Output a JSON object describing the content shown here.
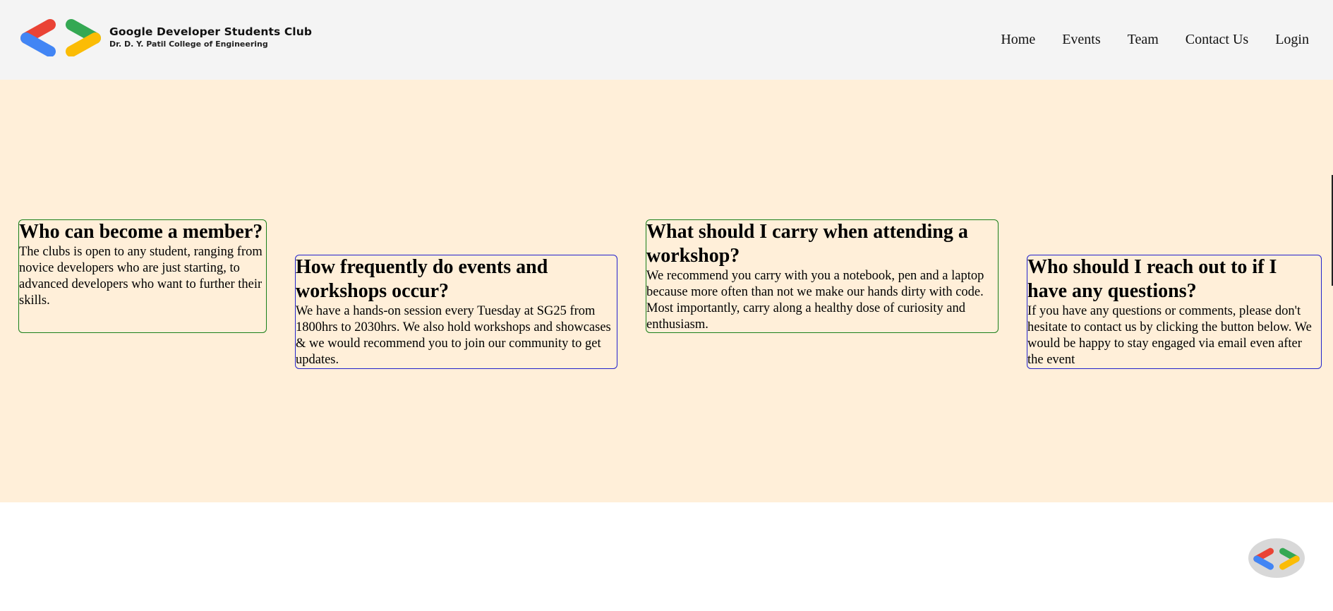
{
  "header": {
    "brand_title": "Google Developer Students Club",
    "brand_subtitle": "Dr. D. Y. Patil College of Engineering",
    "nav": [
      "Home",
      "Events",
      "Team",
      "Contact Us",
      "Login"
    ]
  },
  "faq": [
    {
      "question": "Who can become a member?",
      "answer": "The clubs is open to any student, ranging from novice developers who are just starting, to advanced developers who want to further their skills."
    },
    {
      "question": "How frequently do events and workshops occur?",
      "answer": "We have a hands-on session every Tuesday at SG25 from 1800hrs to 2030hrs. We also hold workshops and showcases & we would recommend you to join our community to get updates."
    },
    {
      "question": "What should I carry when attending a workshop?",
      "answer": "We recommend you carry with you a notebook, pen and a laptop because more often than not we make our hands dirty with code. Most importantly, carry along a healthy dose of curiosity and enthusiasm."
    },
    {
      "question": "Who should I reach out to if I have any questions?",
      "answer": "If you have any questions or comments, please don't hesitate to contact us by clicking the button below. We would be happy to stay engaged via email even after the event"
    }
  ],
  "icons": {
    "logo": "gdsc-logo-icon",
    "footer_logo": "gdsc-logo-icon"
  },
  "colors": {
    "header_bg": "#f4f4f4",
    "band_bg": "#ffefd9",
    "card_green": "#1a7f1a",
    "card_blue": "#2222cc",
    "logo_red": "#ea4335",
    "logo_blue": "#4285f4",
    "logo_green": "#34a853",
    "logo_yellow": "#fbbc05"
  }
}
